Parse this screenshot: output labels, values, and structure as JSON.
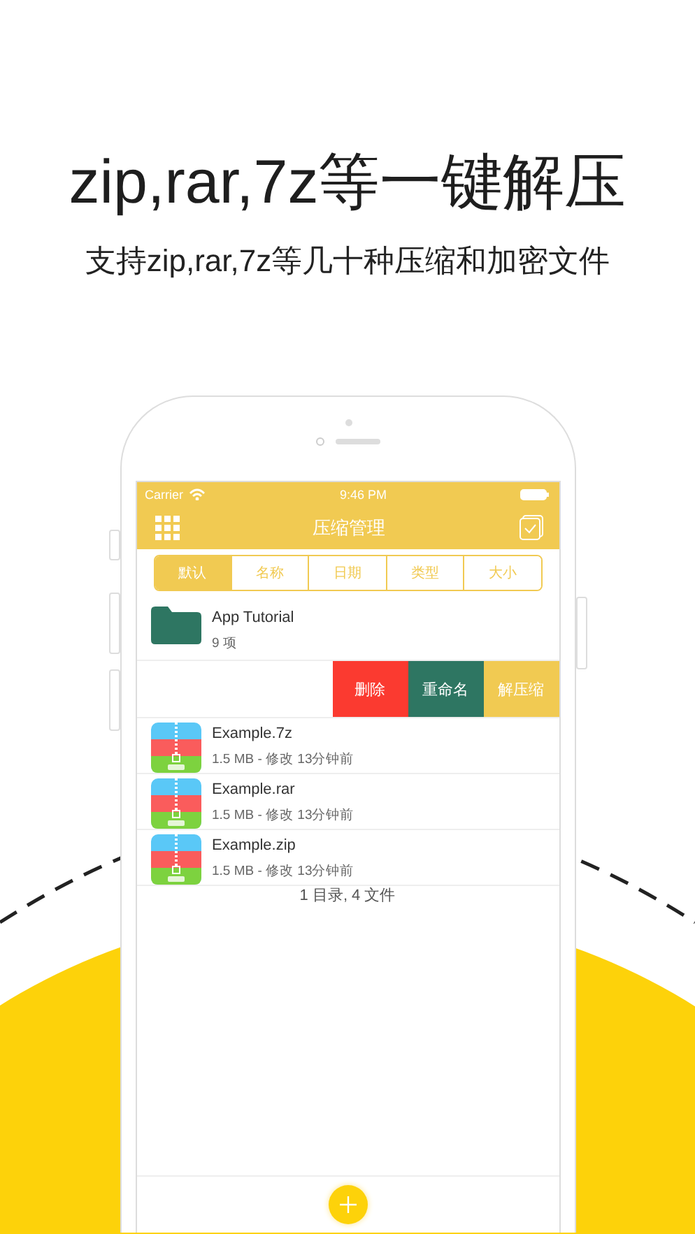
{
  "headline": "zip,rar,7z等一键解压",
  "subtitle": "支持zip,rar,7z等几十种压缩和加密文件",
  "status_bar": {
    "carrier": "Carrier",
    "time": "9:46 PM"
  },
  "nav": {
    "title": "压缩管理"
  },
  "sort_tabs": [
    {
      "label": "默认",
      "selected": true
    },
    {
      "label": "名称",
      "selected": false
    },
    {
      "label": "日期",
      "selected": false
    },
    {
      "label": "类型",
      "selected": false
    },
    {
      "label": "大小",
      "selected": false
    }
  ],
  "folder": {
    "name": "App Tutorial",
    "count": "9 项"
  },
  "swipe_actions": [
    {
      "label": "删除",
      "kind": "delete"
    },
    {
      "label": "重命名",
      "kind": "rename"
    },
    {
      "label": "解压缩",
      "kind": "extract"
    }
  ],
  "files": [
    {
      "name": "Example.7z",
      "info": "1.5 MB - 修改 13分钟前"
    },
    {
      "name": "Example.rar",
      "info": "1.5 MB - 修改 13分钟前"
    },
    {
      "name": "Example.zip",
      "info": "1.5 MB - 修改 13分钟前"
    }
  ],
  "summary": "1 目录, 4 文件"
}
